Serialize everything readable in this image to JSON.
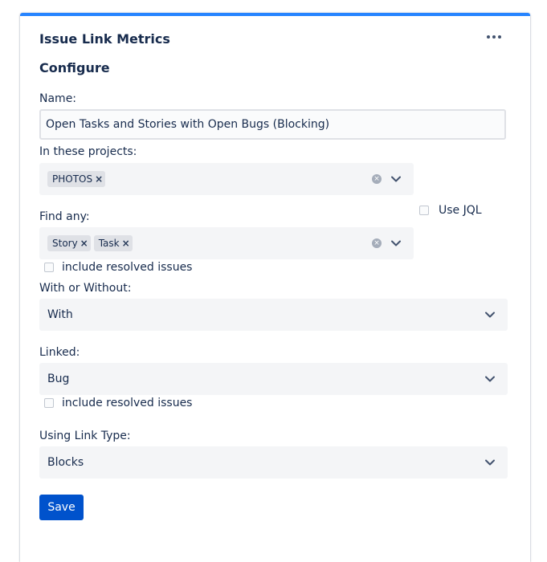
{
  "widget": {
    "title": "Issue Link Metrics",
    "section_title": "Configure",
    "more_icon": "more-horizontal-icon"
  },
  "form": {
    "name_label": "Name:",
    "name_value": "Open Tasks and Stories with Open Bugs (Blocking)",
    "projects_label": "In these projects:",
    "projects": [
      "PHOTOS"
    ],
    "use_jql_label": "Use JQL",
    "find_any_label": "Find any:",
    "find_any": [
      "Story",
      "Task"
    ],
    "include_resolved_1": "include resolved issues",
    "with_without_label": "With or Without:",
    "with_without_value": "With",
    "linked_label": "Linked:",
    "linked_value": "Bug",
    "include_resolved_2": "include resolved issues",
    "link_type_label": "Using Link Type:",
    "link_type_value": "Blocks",
    "save_label": "Save"
  },
  "colors": {
    "accent_border": "#2684ff",
    "primary_button": "#0052cc",
    "select_bg": "#f4f5f7",
    "tag_bg": "#dfe1e6"
  }
}
